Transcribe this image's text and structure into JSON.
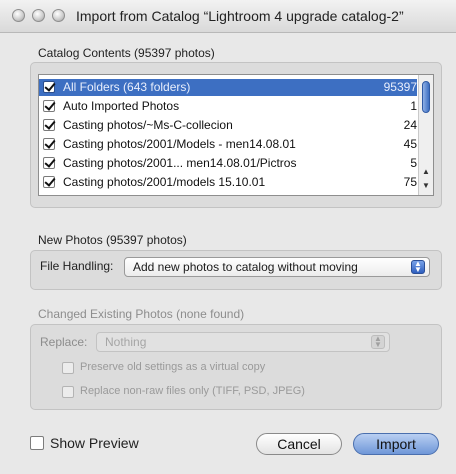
{
  "window": {
    "title": "Import from Catalog “Lightroom 4 upgrade catalog-2”"
  },
  "catalog": {
    "label": "Catalog Contents (95397 photos)",
    "rows": [
      {
        "label": "All Folders (643 folders)",
        "count": "95397",
        "checked": true,
        "selected": true
      },
      {
        "label": "Auto Imported Photos",
        "count": "1",
        "checked": true,
        "selected": false
      },
      {
        "label": "Casting photos/~Ms-C-collecion",
        "count": "24",
        "checked": true,
        "selected": false
      },
      {
        "label": "Casting photos/2001/Models - men14.08.01",
        "count": "45",
        "checked": true,
        "selected": false
      },
      {
        "label": "Casting photos/2001... men14.08.01/Pictros",
        "count": "5",
        "checked": true,
        "selected": false
      },
      {
        "label": "Casting photos/2001/models 15.10.01",
        "count": "75",
        "checked": true,
        "selected": false
      }
    ]
  },
  "new_photos": {
    "label": "New Photos (95397 photos)",
    "file_handling_label": "File Handling:",
    "file_handling_value": "Add new photos to catalog without moving"
  },
  "changed": {
    "label": "Changed Existing Photos (none found)",
    "replace_label": "Replace:",
    "replace_value": "Nothing",
    "preserve_label": "Preserve old settings as a virtual copy",
    "nonraw_label": "Replace non-raw files only (TIFF, PSD, JPEG)"
  },
  "footer": {
    "show_preview_label": "Show Preview",
    "cancel_label": "Cancel",
    "import_label": "Import"
  },
  "colors": {
    "selection": "#3d6fc2",
    "primary_button": "#6f97d8"
  }
}
